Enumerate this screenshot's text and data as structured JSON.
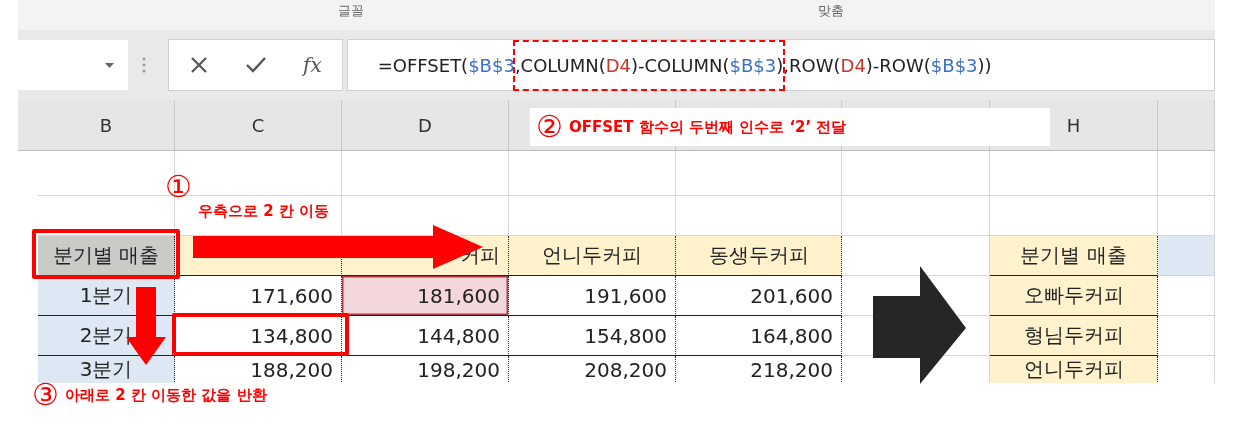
{
  "ribbon": {
    "groups": [
      "글꼴",
      "맞춤"
    ]
  },
  "formula_bar": {
    "fx": "fx",
    "formula": [
      {
        "text": "=OFFSET(",
        "kind": "plain"
      },
      {
        "text": "$B$3",
        "kind": "ref-blue"
      },
      {
        "text": ",COLUMN(",
        "kind": "plain",
        "marked": true
      },
      {
        "text": "D4",
        "kind": "ref-red",
        "marked": true
      },
      {
        "text": ")-COLUMN(",
        "kind": "plain",
        "marked": true
      },
      {
        "text": "$B$3",
        "kind": "ref-blue",
        "marked": true
      },
      {
        "text": ")",
        "kind": "plain",
        "marked": true
      },
      {
        "text": ",ROW(",
        "kind": "plain"
      },
      {
        "text": "D4",
        "kind": "ref-red"
      },
      {
        "text": ")-ROW(",
        "kind": "plain"
      },
      {
        "text": "$B$3",
        "kind": "ref-blue"
      },
      {
        "text": "))",
        "kind": "plain"
      }
    ]
  },
  "columns": [
    {
      "letter": "B"
    },
    {
      "letter": "C"
    },
    {
      "letter": "D"
    },
    {},
    {},
    {},
    {
      "letter": "H"
    },
    {}
  ],
  "rows": [
    {
      "cells": [
        {
          "kind": "empty"
        },
        {
          "kind": "empty"
        },
        {
          "kind": "empty"
        },
        {
          "kind": "empty"
        },
        {
          "kind": "empty"
        },
        {
          "kind": "empty"
        },
        {
          "kind": "empty"
        },
        {
          "kind": "empty"
        }
      ]
    },
    {
      "cells": [
        {
          "kind": "empty"
        },
        {
          "kind": "empty"
        },
        {
          "kind": "empty"
        },
        {
          "kind": "empty"
        },
        {
          "kind": "empty"
        },
        {
          "kind": "empty"
        },
        {
          "kind": "empty"
        },
        {
          "kind": "empty"
        }
      ]
    },
    {
      "cells": [
        {
          "kind": "selected-header",
          "text": "분기별 매출"
        },
        {
          "kind": "header"
        },
        {
          "kind": "header-right",
          "text": "커피"
        },
        {
          "kind": "header",
          "text": "언니두커피"
        },
        {
          "kind": "header",
          "text": "동생두커피"
        },
        {
          "kind": "empty"
        },
        {
          "kind": "header",
          "text": "분기별 매출"
        },
        {
          "kind": "blue"
        }
      ]
    },
    {
      "cells": [
        {
          "kind": "label",
          "text": "1분기"
        },
        {
          "kind": "number",
          "text": "171,600"
        },
        {
          "kind": "precedent",
          "text": "181,600"
        },
        {
          "kind": "number",
          "text": "191,600"
        },
        {
          "kind": "number",
          "text": "201,600"
        },
        {
          "kind": "empty"
        },
        {
          "kind": "header",
          "text": "오빠두커피"
        },
        {
          "kind": "empty"
        }
      ]
    },
    {
      "cells": [
        {
          "kind": "label",
          "text": "2분기"
        },
        {
          "kind": "number",
          "text": "134,800"
        },
        {
          "kind": "number",
          "text": "144,800"
        },
        {
          "kind": "number",
          "text": "154,800"
        },
        {
          "kind": "number",
          "text": "164,800"
        },
        {
          "kind": "empty"
        },
        {
          "kind": "header",
          "text": "형님두커피"
        },
        {
          "kind": "empty"
        }
      ]
    },
    {
      "cells": [
        {
          "kind": "label",
          "text": "3분기"
        },
        {
          "kind": "number",
          "text": "188,200"
        },
        {
          "kind": "number",
          "text": "198,200"
        },
        {
          "kind": "number",
          "text": "208,200"
        },
        {
          "kind": "number",
          "text": "218,200"
        },
        {
          "kind": "empty"
        },
        {
          "kind": "header",
          "text": "언니두커피"
        },
        {
          "kind": "empty"
        }
      ]
    }
  ],
  "annotations": [
    {
      "number": "①",
      "text": "우측으로 2 칸 이동"
    },
    {
      "number": "②",
      "text": "OFFSET 함수의 두번째 인수로 ‘2’ 전달"
    },
    {
      "number": "③",
      "text": "아래로 2 칸 이동한 값을 반환"
    }
  ]
}
